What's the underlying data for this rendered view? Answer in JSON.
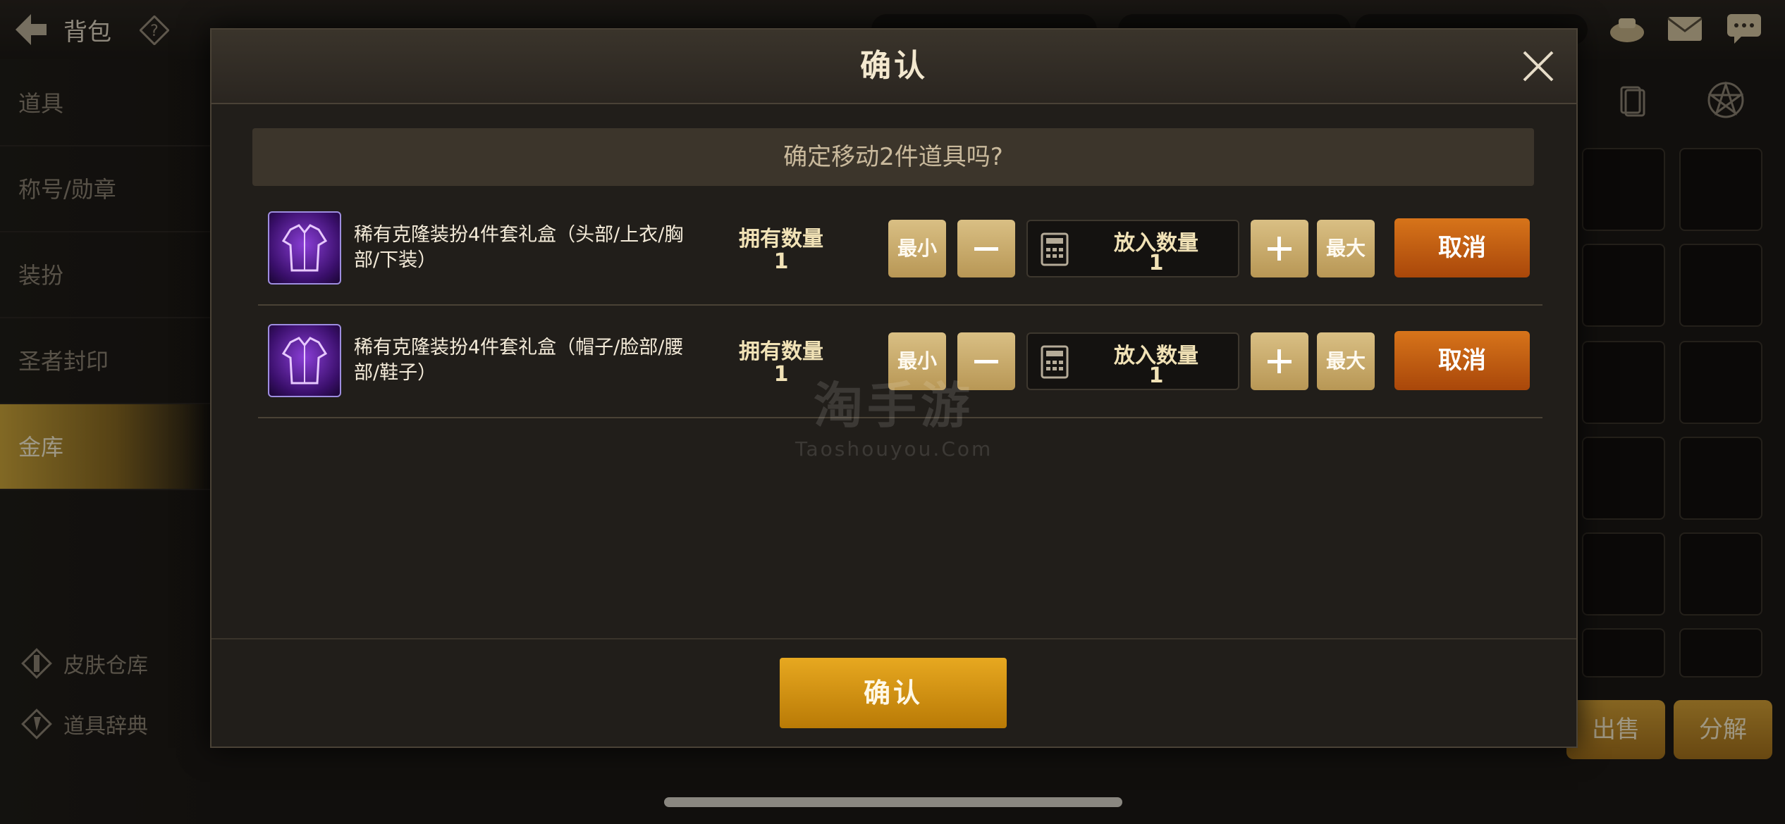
{
  "background": {
    "title": "背包",
    "sidebar_items": [
      "道具",
      "称号/勋章",
      "装扮",
      "圣者封印",
      "金库"
    ],
    "active_item_index": 4,
    "side_links": [
      "皮肤仓库",
      "道具辞典"
    ],
    "sell_label": "出售",
    "decompose_label": "分解"
  },
  "dialog": {
    "title": "确认",
    "question": "确定移动2件道具吗?",
    "own_label": "拥有数量",
    "put_label": "放入数量",
    "min_label": "最小",
    "max_label": "最大",
    "cancel_label": "取消",
    "confirm_label": "确认",
    "items": [
      {
        "name": "稀有克隆装扮4件套礼盒（头部/上衣/胸部/下装）",
        "own": "1",
        "put": "1"
      },
      {
        "name": "稀有克隆装扮4件套礼盒（帽子/脸部/腰部/鞋子）",
        "own": "1",
        "put": "1"
      }
    ]
  },
  "watermark": {
    "big": "淘手游",
    "small": "Taoshouyou.Com"
  },
  "colors": {
    "accent_gold": "#e7a820",
    "cancel_orange": "#d7741a",
    "rare_purple": "#8a3ed6"
  }
}
